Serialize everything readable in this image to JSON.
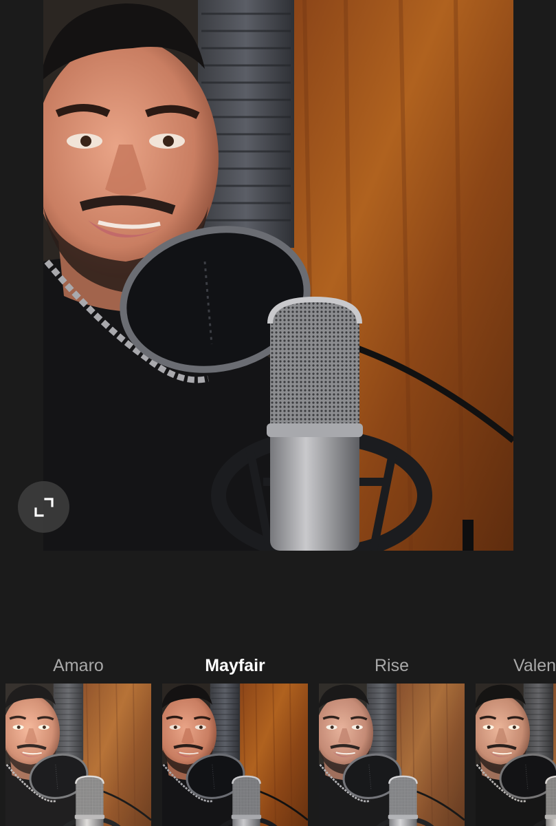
{
  "preview": {
    "image": "photo-of-man-with-studio-microphone",
    "expand_icon": "expand-icon"
  },
  "filters": [
    {
      "name": "Amaro",
      "selected": false
    },
    {
      "name": "Mayfair",
      "selected": true
    },
    {
      "name": "Rise",
      "selected": false
    },
    {
      "name": "Valencia",
      "selected": false
    }
  ],
  "colors": {
    "background": "#1b1b1b",
    "selected_label": "#ffffff",
    "unselected_label": "#a9a9a9"
  }
}
